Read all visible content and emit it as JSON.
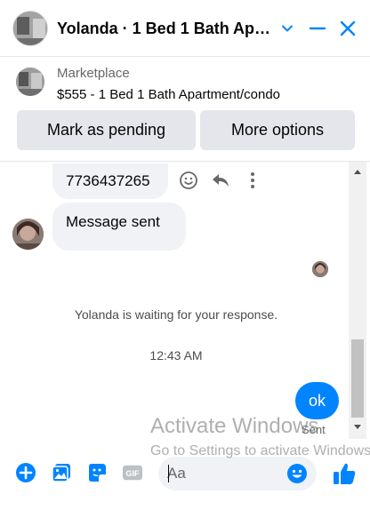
{
  "header": {
    "title": "Yolanda · 1 Bed 1 Bath Apartment/condo",
    "icons": [
      "chevron-down-icon",
      "minimize-icon",
      "close-icon"
    ],
    "accent_color": "#0084ff"
  },
  "listing": {
    "source": "Marketplace",
    "price_title": "$555 - 1 Bed 1 Bath Apartment/condo",
    "buttons": [
      "Mark as pending",
      "More options"
    ]
  },
  "messages": {
    "phone_message": "7736437265",
    "message_sent": "Message sent",
    "waiting_notice": "Yolanda is waiting for your response.",
    "timestamp": "12:43 AM",
    "outgoing_text": "ok",
    "outgoing_status": "Sent",
    "message_tools": [
      "emoji-react-icon",
      "reply-icon",
      "more-options-icon"
    ]
  },
  "watermark": {
    "line1": "Activate Windows",
    "line2": "Go to Settings to activate Windows."
  },
  "composer": {
    "placeholder": "Aa",
    "icons": [
      "add-icon",
      "photo-icon",
      "sticker-icon",
      "gif-icon",
      "emoji-icon",
      "like-icon"
    ]
  }
}
